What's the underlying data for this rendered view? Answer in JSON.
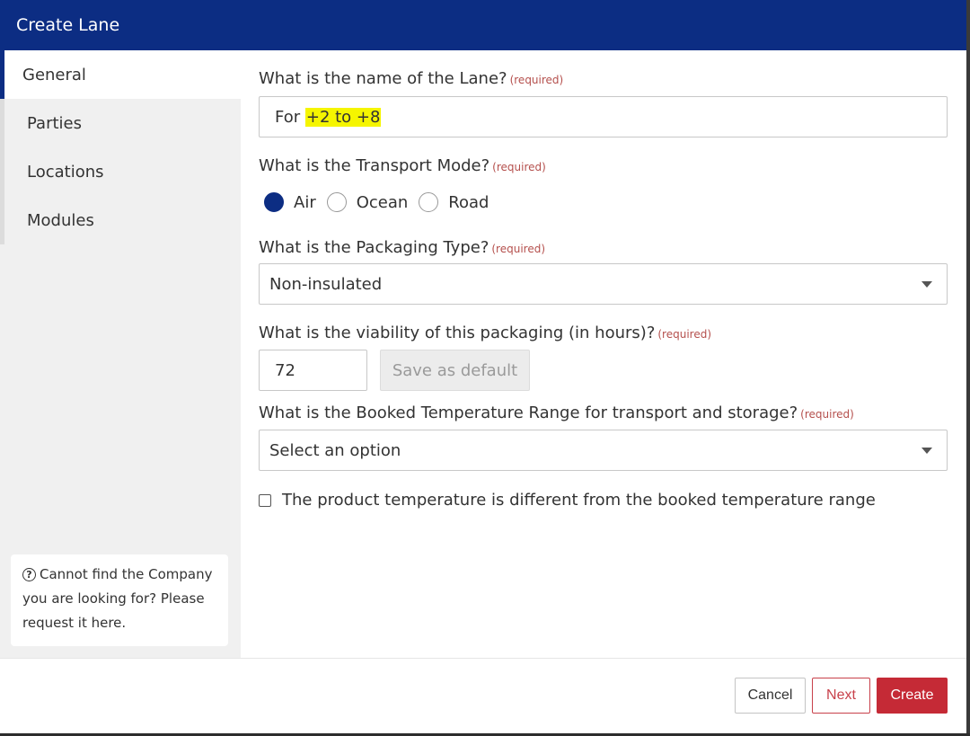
{
  "dialog": {
    "title": "Create Lane"
  },
  "sidebar": {
    "items": [
      {
        "label": "General",
        "active": true
      },
      {
        "label": "Parties",
        "active": false
      },
      {
        "label": "Locations",
        "active": false
      },
      {
        "label": "Modules",
        "active": false
      }
    ],
    "help": {
      "icon": "question-circle-icon",
      "line1": "Cannot find the Company",
      "line2": "you are looking for? Please",
      "line3": "request it here."
    }
  },
  "form": {
    "required_tag": "(required)",
    "name": {
      "question": "What is the name of the Lane?",
      "value_prefix": "For ",
      "value_highlighted": "+2 to +8",
      "highlight_color": "#f5f500"
    },
    "transport_mode": {
      "question": "What is the Transport Mode?",
      "options": [
        "Air",
        "Ocean",
        "Road"
      ],
      "selected": "Air"
    },
    "packaging_type": {
      "question": "What is the Packaging Type?",
      "selected": "Non-insulated"
    },
    "viability": {
      "question": "What is the viability of this packaging (in hours)?",
      "value": "72",
      "save_default_label": "Save as default"
    },
    "temperature_range": {
      "question": "What is the Booked Temperature Range for transport and storage?",
      "placeholder": "Select an option"
    },
    "product_temp_checkbox": {
      "label": "The product temperature is different from the booked temperature range",
      "checked": false
    }
  },
  "footer": {
    "cancel_label": "Cancel",
    "next_label": "Next",
    "create_label": "Create"
  },
  "colors": {
    "header": "#0c2d83",
    "accent_red": "#c52a36",
    "required_text": "#b5504d"
  }
}
